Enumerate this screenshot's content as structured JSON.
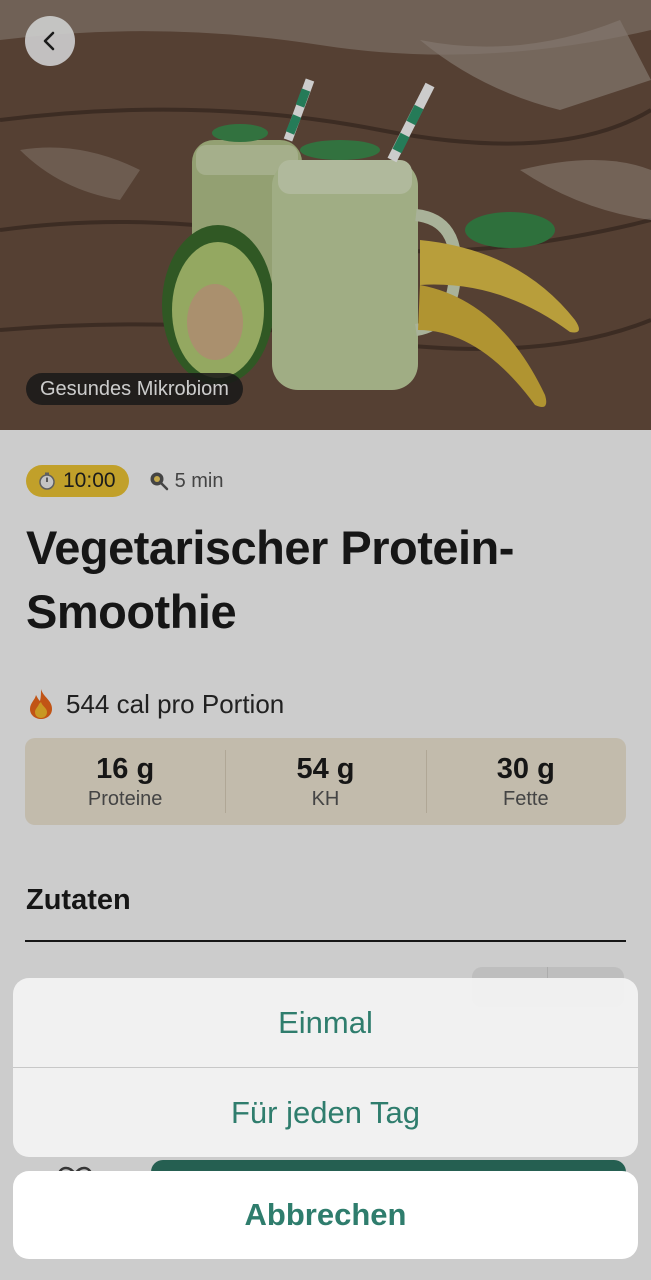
{
  "hero": {
    "tag": "Gesundes Mikrobiom"
  },
  "meta": {
    "timer": "10:00",
    "duration": "5 min"
  },
  "recipe": {
    "title": "Vegetarischer Protein-Smoothie"
  },
  "calories": {
    "text": "544 cal pro Portion"
  },
  "macros": [
    {
      "value": "16 g",
      "label": "Proteine"
    },
    {
      "value": "54 g",
      "label": "KH"
    },
    {
      "value": "30 g",
      "label": "Fette"
    }
  ],
  "ingredients": {
    "title": "Zutaten"
  },
  "action_sheet": {
    "options": [
      "Einmal",
      "Für jeden Tag"
    ],
    "cancel": "Abbrechen"
  },
  "colors": {
    "accent": "#2f7d6d",
    "timer_badge": "#f2c935",
    "macro_bg": "#f3ead8"
  },
  "icons": {
    "back": "chevron-left-icon",
    "timer": "stopwatch-icon",
    "duration": "frying-pan-icon",
    "calories": "fire-icon"
  }
}
